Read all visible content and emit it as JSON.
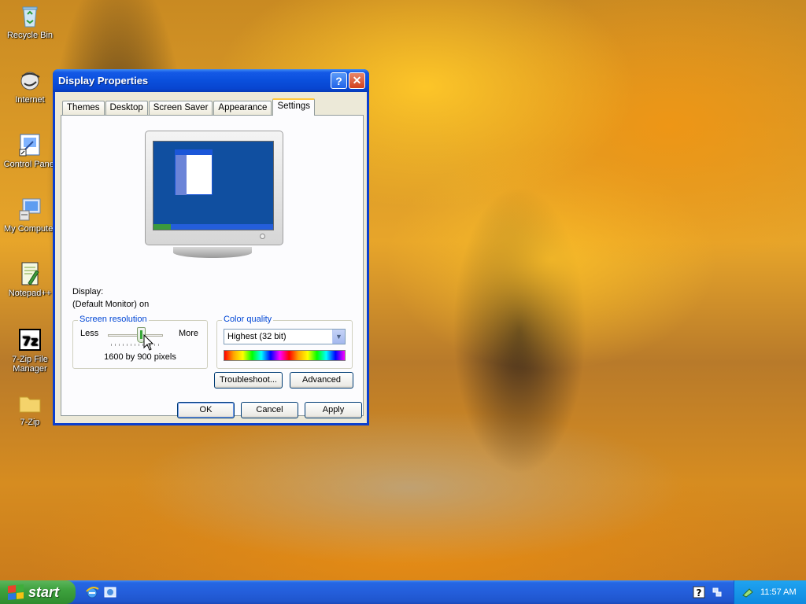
{
  "desktop": {
    "icons": [
      {
        "label": "Recycle Bin",
        "icon": "recycle-bin-icon"
      },
      {
        "label": "Internet",
        "icon": "internet-icon"
      },
      {
        "label": "Control Panel",
        "icon": "control-panel-icon"
      },
      {
        "label": "My Computer",
        "icon": "my-computer-icon"
      },
      {
        "label": "Notepad++",
        "icon": "notepad-plus-plus-icon"
      },
      {
        "label": "7-Zip File Manager",
        "icon": "seven-zip-icon"
      },
      {
        "label": "7-Zip",
        "icon": "folder-icon"
      }
    ]
  },
  "window": {
    "title": "Display Properties",
    "help_glyph": "?",
    "close_glyph": "✕",
    "tabs": [
      "Themes",
      "Desktop",
      "Screen Saver",
      "Appearance",
      "Settings"
    ],
    "active_tab": "Settings",
    "display_label": "Display:",
    "display_value": "(Default Monitor) on",
    "screen_resolution": {
      "title": "Screen resolution",
      "less": "Less",
      "more": "More",
      "value_text": "1600 by 900 pixels",
      "slider_fraction": 0.6
    },
    "color_quality": {
      "title": "Color quality",
      "selected": "Highest (32 bit)"
    },
    "buttons": {
      "troubleshoot": "Troubleshoot...",
      "advanced": "Advanced",
      "ok": "OK",
      "cancel": "Cancel",
      "apply": "Apply"
    }
  },
  "taskbar": {
    "start_label": "start",
    "clock": "11:57 AM"
  },
  "colors": {
    "titlebar": "#0a4fdc",
    "taskbar": "#245edb",
    "start": "#3ea23e",
    "tray": "#0e8ae0",
    "group_title": "#0046d5"
  }
}
